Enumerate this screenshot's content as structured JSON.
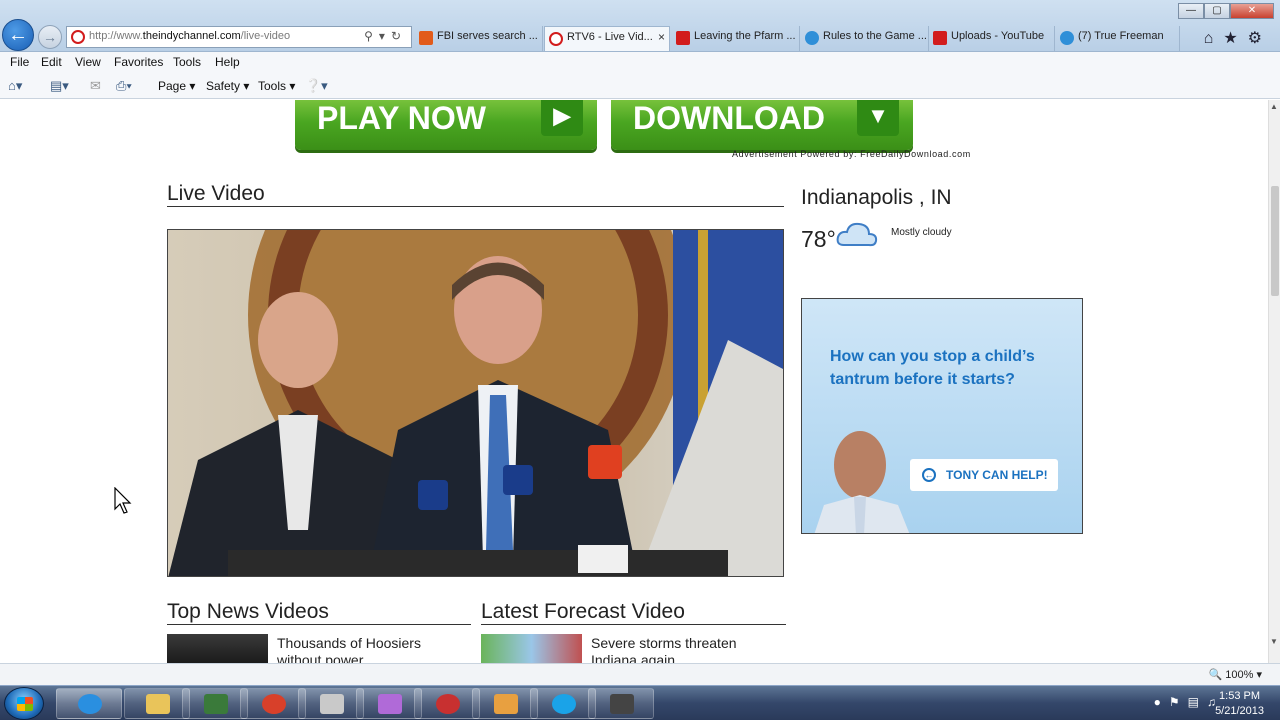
{
  "browser": {
    "address": {
      "url_prefix": "http://www.",
      "url_domain": "theindychannel.com",
      "url_path": "/live-video"
    },
    "tabs": [
      {
        "label": "FBI serves search ...",
        "icon_color": "#e25b1a",
        "active": false
      },
      {
        "label": "RTV6 - Live Vid...",
        "icon_color": "#d21c1c",
        "active": true,
        "close_glyph": "×"
      },
      {
        "label": "Leaving the Pfarm ...",
        "icon_color": "#d21c1c",
        "active": false
      },
      {
        "label": "Rules to the Game ...",
        "icon_color": "#2f8fd8",
        "active": false
      },
      {
        "label": "Uploads - YouTube",
        "icon_color": "#d21c1c",
        "active": false
      },
      {
        "label": "(7) True Freeman",
        "icon_color": "#2f8fd8",
        "active": false
      }
    ],
    "window_controls": {
      "minimize": "—",
      "maximize": "▢",
      "close": "✕"
    },
    "right_icons": [
      "home-icon",
      "favorites-star-icon",
      "settings-gear-icon"
    ]
  },
  "menubar": {
    "items": [
      "File",
      "Edit",
      "View",
      "Favorites",
      "Tools",
      "Help"
    ]
  },
  "commandbar": {
    "page_label": "Page",
    "safety_label": "Safety",
    "tools_label": "Tools"
  },
  "page": {
    "ad": {
      "play_label": "PLAY NOW",
      "download_label": "DOWNLOAD",
      "note": "Advertisement Powered by:  FreeDailyDownload.com"
    },
    "live_video_title": "Live Video",
    "weather": {
      "location": "Indianapolis , IN",
      "temperature": "78°",
      "condition": "Mostly cloudy",
      "icon": "cloud-icon"
    },
    "side_ad": {
      "question": "How can you stop a child’s tantrum before it starts?",
      "cta": "TONY CAN HELP!"
    },
    "top_news": {
      "title": "Top News Videos",
      "first_item": "Thousands of Hoosiers without power"
    },
    "forecast": {
      "title": "Latest Forecast Video",
      "first_item": "Severe storms threaten Indiana again"
    }
  },
  "statusbar": {
    "zoom": "100%"
  },
  "taskbar": {
    "apps": [
      {
        "name": "internet-explorer-icon",
        "color": "#2a8fe0"
      },
      {
        "name": "file-explorer-icon",
        "color": "#e9c45a"
      },
      {
        "name": "camtasia-icon",
        "color": "#3a7a3a"
      },
      {
        "name": "filezilla-icon",
        "color": "#d8402a"
      },
      {
        "name": "scanner-icon",
        "color": "#c9c9c9"
      },
      {
        "name": "app-grid-icon",
        "color": "#b06ad8"
      },
      {
        "name": "tv-tuner-icon",
        "color": "#c83030"
      },
      {
        "name": "paint-icon",
        "color": "#e8a040"
      },
      {
        "name": "skype-icon",
        "color": "#1aa3e8"
      },
      {
        "name": "recorder-icon",
        "color": "#444444"
      }
    ],
    "clock_time": "1:53 PM",
    "clock_date": "5/21/2013"
  },
  "colors": {
    "accent_blue": "#1b72c0",
    "ad_green": "#4aa621"
  }
}
